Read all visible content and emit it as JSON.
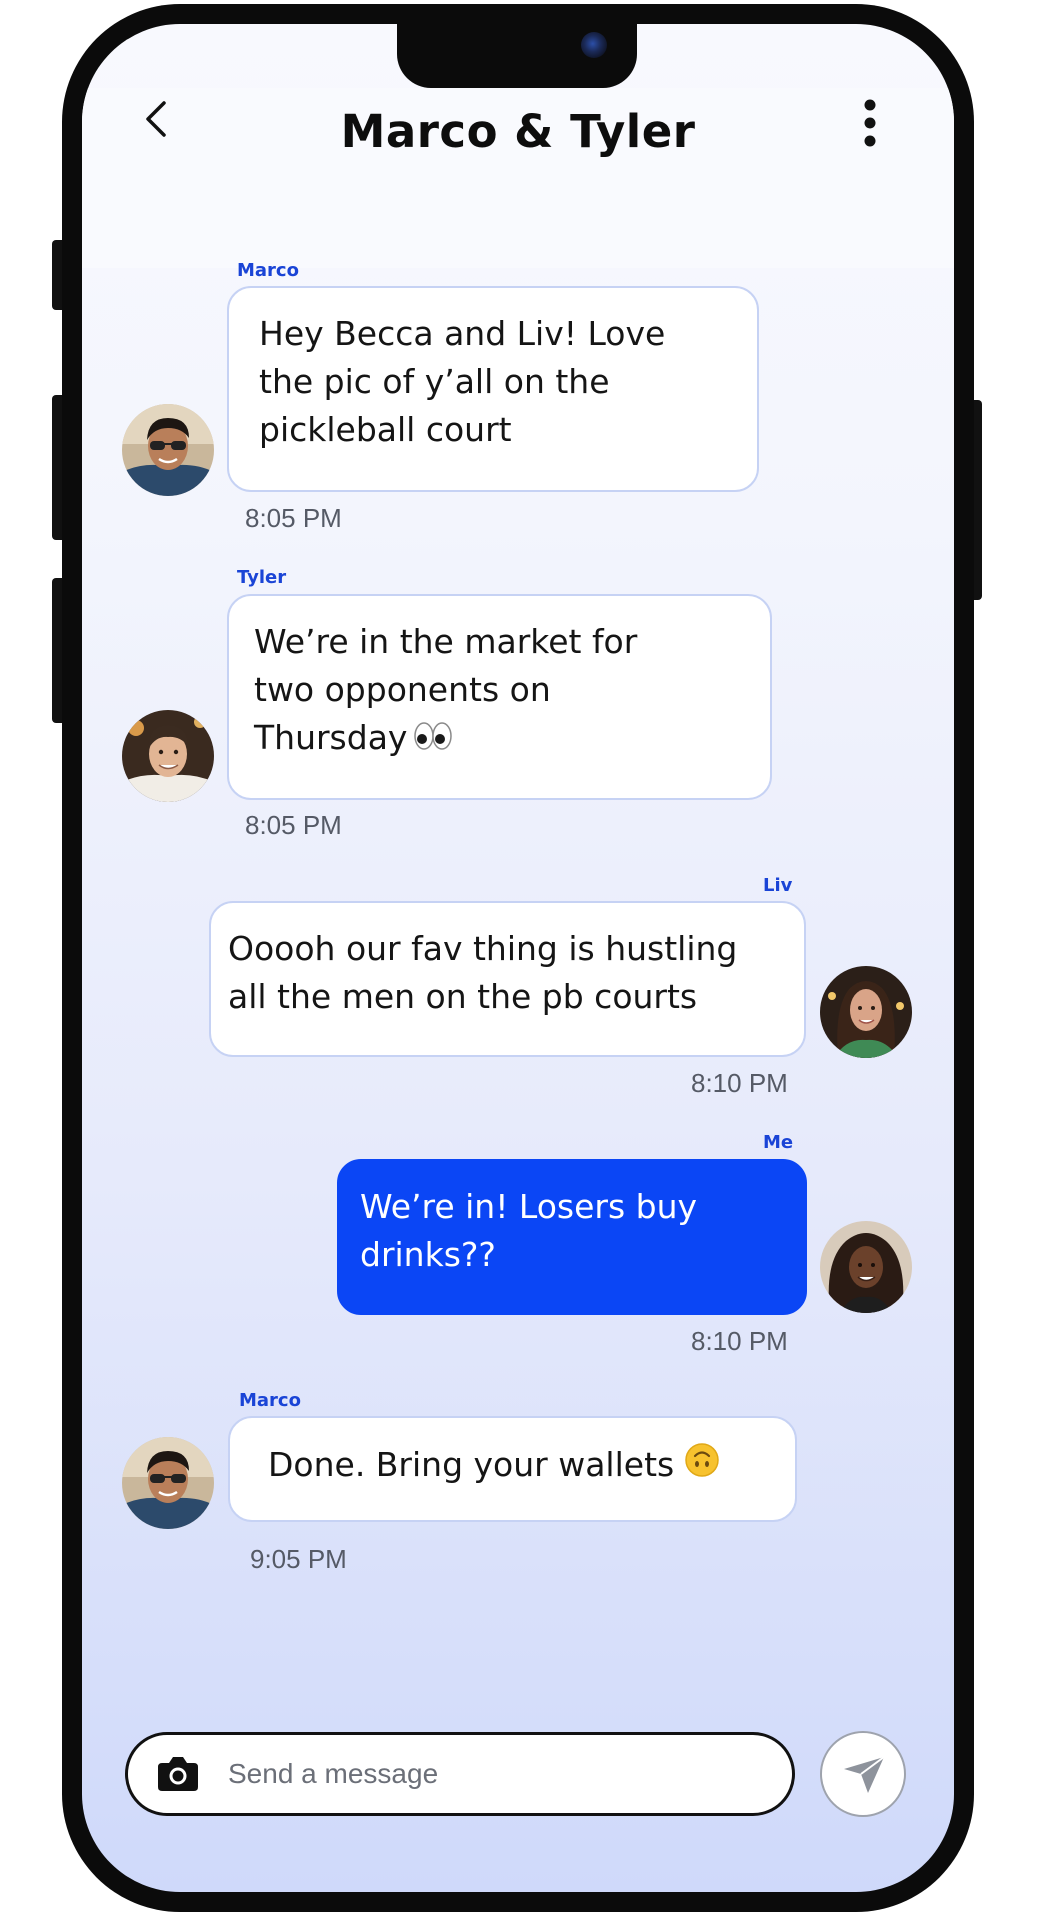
{
  "chat": {
    "title": "Marco & Tyler"
  },
  "messages": [
    {
      "sender": "Marco",
      "text": "Hey Becca and Liv! Love\nthe pic of y’all on the\npickleball court",
      "time": "8:05 PM"
    },
    {
      "sender": "Tyler",
      "text": "We’re in the market for\ntwo opponents on\nThursday",
      "emoji": "eyes-emoji",
      "time": "8:05 PM"
    },
    {
      "sender": "Liv",
      "text": "Ooooh our fav thing is hustling\nall the men on the pb courts",
      "time": "8:10 PM"
    },
    {
      "sender": "Me",
      "text": "We’re in! Losers buy\ndrinks??",
      "time": "8:10 PM"
    },
    {
      "sender": "Marco",
      "text": "Done. Bring your wallets",
      "emoji": "upside-down-face-emoji",
      "time": "9:05 PM"
    }
  ],
  "composer": {
    "placeholder": "Send a message",
    "value": ""
  },
  "icons": {
    "back": "chevron-left-icon",
    "more": "more-vertical-icon",
    "camera": "camera-icon",
    "send": "send-icon"
  },
  "colors": {
    "accent": "#0b46f5",
    "sender_name": "#1a44d6",
    "bubble_border": "#c6d2f4"
  }
}
